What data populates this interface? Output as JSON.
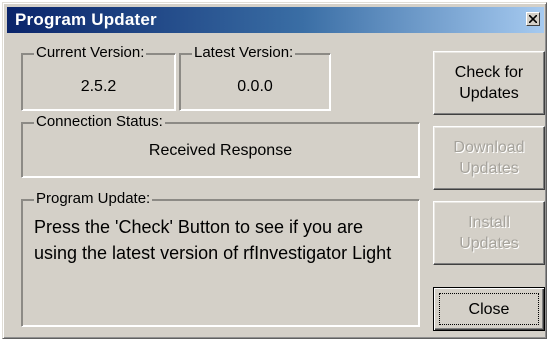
{
  "window": {
    "title": "Program Updater"
  },
  "current_version": {
    "label": "Current Version:",
    "value": "2.5.2"
  },
  "latest_version": {
    "label": "Latest Version:",
    "value": "0.0.0"
  },
  "connection_status": {
    "label": "Connection Status:",
    "value": "Received Response"
  },
  "program_update": {
    "label": "Program Update:",
    "message": "Press the 'Check' Button to see if you are using the latest version of rfInvestigator Light"
  },
  "buttons": {
    "check": "Check for Updates",
    "download": "Download Updates",
    "install": "Install Updates",
    "close": "Close"
  },
  "icons": {
    "title_close": "close-icon"
  }
}
